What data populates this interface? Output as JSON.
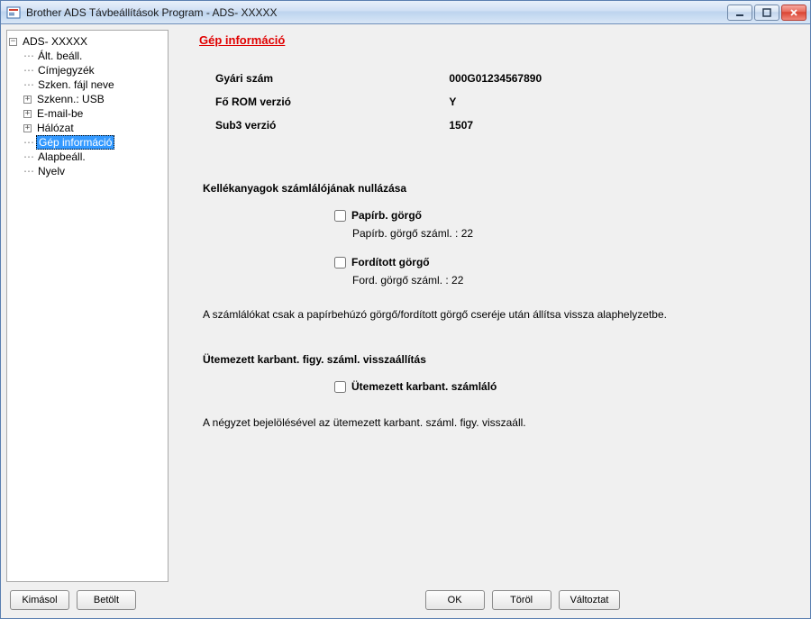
{
  "window": {
    "title": "Brother ADS Távbeállítások Program - ADS- XXXXX"
  },
  "tree": {
    "root": {
      "label": "ADS- XXXXX",
      "expanded": true
    },
    "items": [
      {
        "label": "Ált. beáll.",
        "expandable": false
      },
      {
        "label": "Címjegyzék",
        "expandable": false
      },
      {
        "label": "Szken. fájl neve",
        "expandable": false
      },
      {
        "label": "Szkenn.: USB",
        "expandable": true
      },
      {
        "label": "E-mail-be",
        "expandable": true
      },
      {
        "label": "Hálózat",
        "expandable": true
      },
      {
        "label": "Gép információ",
        "expandable": false,
        "selected": true
      },
      {
        "label": "Alapbeáll.",
        "expandable": false
      },
      {
        "label": "Nyelv",
        "expandable": false
      }
    ]
  },
  "panel": {
    "title": "Gép információ",
    "info": {
      "serial_label": "Gyári szám",
      "serial_value": "000G01234567890",
      "mainrom_label": "Fő ROM verzió",
      "mainrom_value": "Y",
      "sub3_label": "Sub3 verzió",
      "sub3_value": "1507"
    },
    "reset_supplies": {
      "heading": "Kellékanyagok számlálójának nullázása",
      "pickup_label": "Papírb. görgő",
      "pickup_count_label": "Papírb. görgő száml. : 22",
      "reverse_label": "Fordított görgő",
      "reverse_count_label": "Ford. görgő száml. : 22",
      "note": "A számlálókat csak a papírbehúzó görgő/fordított görgő cseréje után állítsa vissza alaphelyzetbe."
    },
    "sched_maint": {
      "heading": "Ütemezett karbant. figy. száml. visszaállítás",
      "checkbox_label": "Ütemezett karbant. számláló",
      "note": "A négyzet bejelölésével az ütemezett karbant. száml. figy. visszaáll."
    }
  },
  "buttons": {
    "export": "Kimásol",
    "import": "Betölt",
    "ok": "OK",
    "cancel": "Töröl",
    "apply": "Változtat"
  }
}
